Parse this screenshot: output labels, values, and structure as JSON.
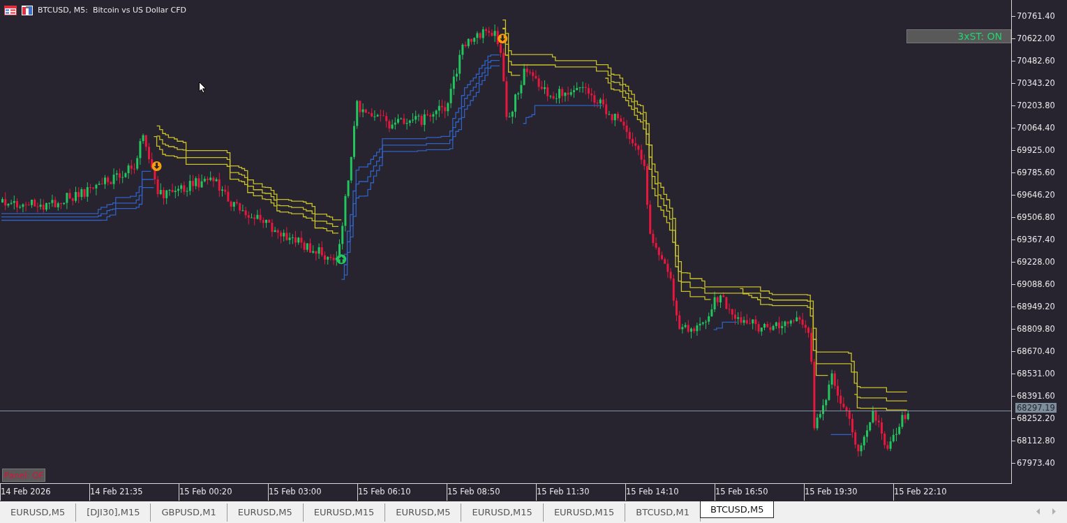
{
  "chart_window": {
    "title": "BTCUSD, M5:  Bitcoin vs US Dollar CFD",
    "toggles": [
      {
        "label": "3xST: ON",
        "on": true,
        "kind": "top"
      },
      {
        "label": "Panel: OF",
        "on": false,
        "kind": "bottom"
      }
    ],
    "current_price": "68297.19",
    "price_axis": [
      "70761.40",
      "70622.00",
      "70482.60",
      "70343.20",
      "70203.80",
      "70064.40",
      "69925.00",
      "69785.60",
      "69646.20",
      "69506.80",
      "69367.40",
      "69228.00",
      "69088.60",
      "68949.20",
      "68809.80",
      "68670.40",
      "68531.00",
      "68391.60",
      "68252.20",
      "68112.80",
      "67973.40"
    ],
    "time_axis": [
      "14 Feb 2026",
      "14 Feb 21:35",
      "15 Feb 00:20",
      "15 Feb 03:00",
      "15 Feb 06:10",
      "15 Feb 08:50",
      "15 Feb 11:30",
      "15 Feb 14:10",
      "15 Feb 16:50",
      "15 Feb 19:30",
      "15 Feb 22:10"
    ]
  },
  "tabs": [
    {
      "label": "EURUSD,M5",
      "selected": false
    },
    {
      "label": "[DJI30],M15",
      "selected": false
    },
    {
      "label": "GBPUSD,M1",
      "selected": false
    },
    {
      "label": "EURUSD,M5",
      "selected": false
    },
    {
      "label": "EURUSD,M15",
      "selected": false
    },
    {
      "label": "EURUSD,M5",
      "selected": false
    },
    {
      "label": "EURUSD,M15",
      "selected": false
    },
    {
      "label": "EURUSD,M15",
      "selected": false
    },
    {
      "label": "BTCUSD,M1",
      "selected": false
    },
    {
      "label": "BTCUSD,M5",
      "selected": true
    }
  ]
}
